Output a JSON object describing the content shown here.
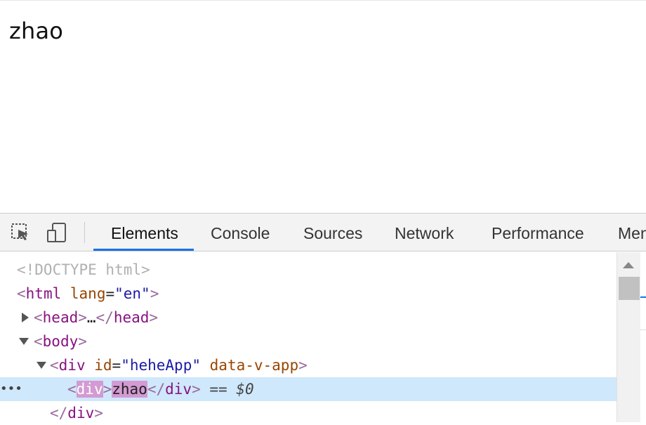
{
  "page": {
    "text": "zhao"
  },
  "devtools": {
    "tools": {
      "inspect_icon": "inspect-element-icon",
      "device_icon": "device-toolbar-icon"
    },
    "tabs": [
      {
        "label": "Elements",
        "active": true
      },
      {
        "label": "Console"
      },
      {
        "label": "Sources"
      },
      {
        "label": "Network"
      },
      {
        "label": "Performance"
      },
      {
        "label": "Men"
      }
    ],
    "accent_color": "#1a73e8",
    "tree": {
      "doctype": "<!DOCTYPE html>",
      "html_open": {
        "lt": "<",
        "tag": "html",
        "attr": "lang",
        "eq": "=",
        "value": "\"en\"",
        "gt": ">"
      },
      "head": {
        "lt": "<",
        "tag": "head",
        "gt": ">",
        "ellipsis": "…",
        "close_lt": "</",
        "close_gt": ">"
      },
      "body": {
        "lt": "<",
        "tag": "body",
        "gt": ">"
      },
      "div_app": {
        "lt": "<",
        "tag": "div",
        "attr1": "id",
        "eq": "=",
        "value1": "\"heheApp\"",
        "attr2": "data-v-app",
        "gt": ">"
      },
      "div_zhao": {
        "dots": "•••",
        "lt": "<",
        "tag": "div",
        "gt": ">",
        "text": "zhao",
        "close_lt": "</",
        "close_tag": "div",
        "close_gt": ">",
        "marker": "== $0"
      },
      "div_close": {
        "lt": "</",
        "tag": "div",
        "gt": ">"
      }
    }
  }
}
